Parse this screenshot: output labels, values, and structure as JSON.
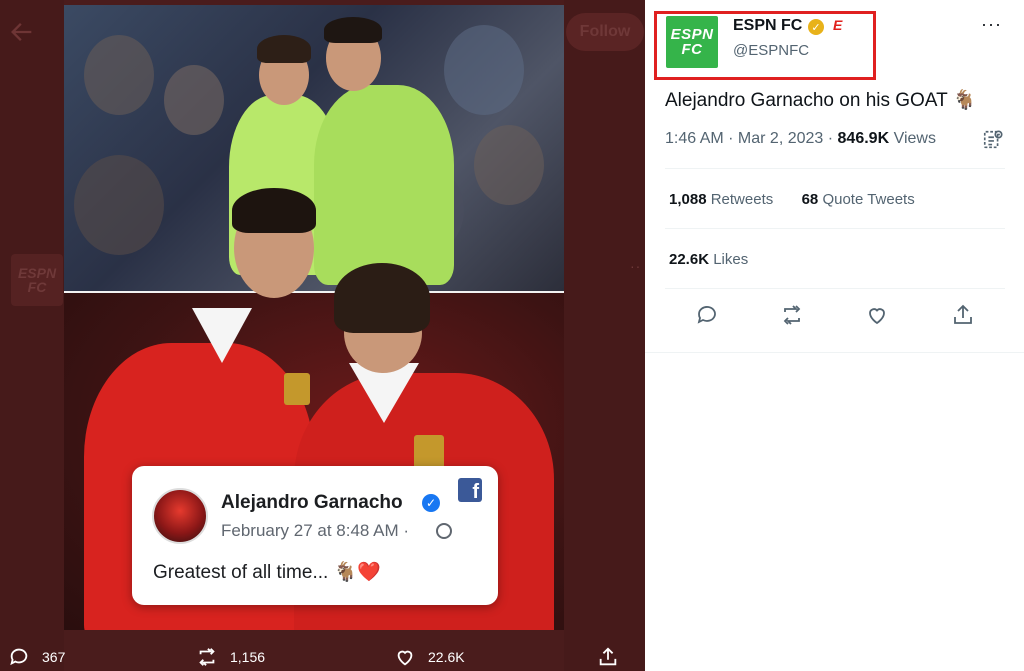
{
  "viewer": {
    "follow_label": "Follow",
    "ghost_avatar_label": "ESPN FC",
    "facebook_card": {
      "name": "Alejandro Garnacho",
      "date": "February 27 at 8:48 AM ·",
      "text": "Greatest of all time... 🐐❤️",
      "verified_mark": "✓",
      "logo": "f"
    },
    "actions": {
      "replies": "367",
      "retweets": "1,156",
      "likes": "22.6K"
    }
  },
  "tweet": {
    "account_name": "ESPN FC",
    "account_handle": "@ESPNFC",
    "avatar_label": "ESPN FC",
    "verified_mark": "✓",
    "brand_mark": "E",
    "text": "Alejandro Garnacho on his GOAT 🐐",
    "time": "1:46 AM · Mar 2, 2023 · ",
    "views_count": "846.9K",
    "views_label": " Views",
    "retweets_count": "1,088",
    "retweets_label": " Retweets",
    "quote_count": "68",
    "quote_label": " Quote Tweets",
    "likes_count": "22.6K",
    "likes_label": " Likes",
    "more": "···"
  },
  "colors": {
    "highlight": "#e02020",
    "espn_green": "#35b44a",
    "verified_gold": "#e8b21a",
    "facebook_blue": "#1877f2"
  }
}
